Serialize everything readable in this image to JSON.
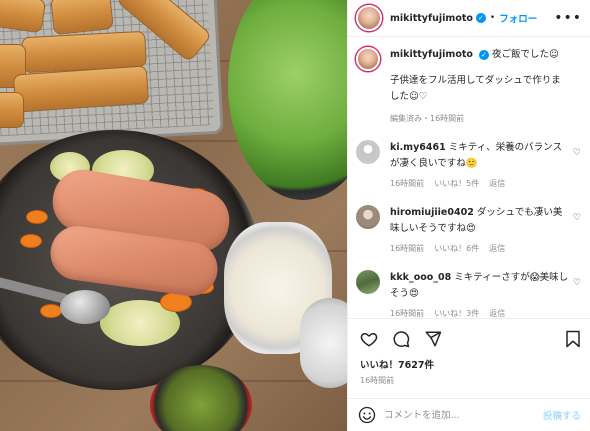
{
  "post": {
    "username": "mikittyfujimoto",
    "follow_label": "フォロー",
    "more_label": "•••"
  },
  "caption": {
    "username": "mikittyfujimoto",
    "line1": "夜ご飯でした☺︎",
    "line2": "子供達をフル活用してダッシュで作りました☺︎♡",
    "meta": "編集済み・16時間前"
  },
  "comments": [
    {
      "username": "ki.my6461",
      "text": "ミキティ、栄養のバランスが凄く良いですね🙂",
      "time": "16時間前",
      "likes": "いいね！5件",
      "reply": "返信"
    },
    {
      "username": "hiromiujiie0402",
      "text": "ダッシュでも凄い美味しいそうですね😍",
      "time": "16時間前",
      "likes": "いいね！6件",
      "reply": "返信"
    },
    {
      "username": "kkk_ooo_08",
      "text": "ミキティーさすが😱美味しそう😍",
      "time": "16時間前",
      "likes": "いいね！3件",
      "reply": "返信"
    }
  ],
  "actions": {
    "likes": "いいね！7627件",
    "time": "16時間前"
  },
  "add_comment": {
    "placeholder": "コメントを追加...",
    "post_label": "投稿する"
  },
  "colors": {
    "accent": "#0095f6",
    "muted": "#8e8e8e",
    "text": "#262626"
  }
}
